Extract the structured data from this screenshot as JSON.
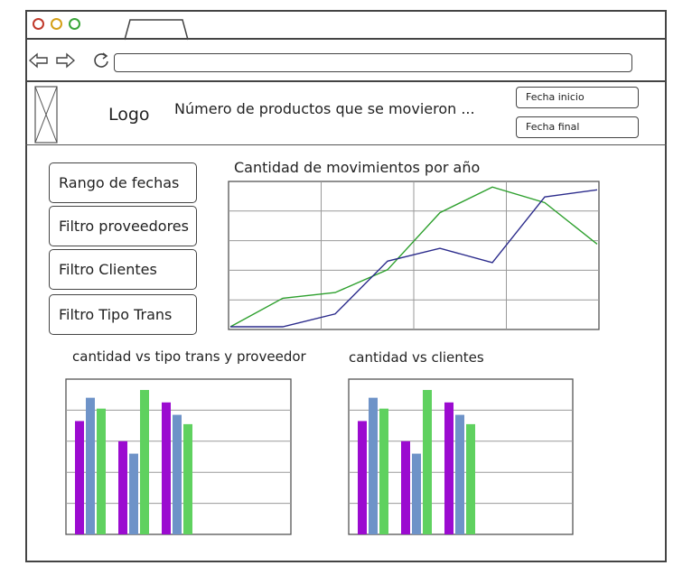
{
  "header": {
    "logo_text": "Logo",
    "title": "Número de productos que se movieron ...",
    "date_start_label": "Fecha inicio",
    "date_end_label": "Fecha final"
  },
  "filters": [
    {
      "label": "Rango de fechas"
    },
    {
      "label": "Filtro proveedores"
    },
    {
      "label": "Filtro Clientes"
    },
    {
      "label": "Filtro Tipo Trans"
    }
  ],
  "colors": {
    "green": "#2ea02e",
    "blue": "#2c2c8c",
    "purple": "#9b0bd0",
    "steel": "#6e93c8",
    "lime": "#5fd15f"
  },
  "chart_data": [
    {
      "type": "line",
      "title": "Cantidad de movimientos por año",
      "x": [
        1,
        2,
        3,
        4,
        5,
        6,
        7,
        8
      ],
      "ylim": [
        0,
        100
      ],
      "grid": true,
      "series": [
        {
          "values": [
            0,
            20,
            24,
            40,
            80,
            98,
            87,
            58
          ],
          "color": "#2ea02e"
        },
        {
          "values": [
            0,
            0,
            9,
            46,
            55,
            45,
            91,
            96
          ],
          "color": "#2c2c8c"
        }
      ]
    },
    {
      "type": "bar",
      "title": "cantidad vs tipo trans y proveedor",
      "categories": [
        "",
        "",
        ""
      ],
      "ylim": [
        0,
        100
      ],
      "grid": true,
      "series": [
        {
          "values": [
            73,
            60,
            85
          ],
          "color": "#9b0bd0"
        },
        {
          "values": [
            88,
            52,
            77
          ],
          "color": "#6e93c8"
        },
        {
          "values": [
            81,
            93,
            71
          ],
          "color": "#5fd15f"
        }
      ]
    },
    {
      "type": "bar",
      "title": "cantidad vs clientes",
      "categories": [
        "",
        "",
        ""
      ],
      "ylim": [
        0,
        100
      ],
      "grid": true,
      "series": [
        {
          "values": [
            73,
            60,
            85
          ],
          "color": "#9b0bd0"
        },
        {
          "values": [
            88,
            52,
            77
          ],
          "color": "#6e93c8"
        },
        {
          "values": [
            81,
            93,
            71
          ],
          "color": "#5fd15f"
        }
      ]
    }
  ]
}
